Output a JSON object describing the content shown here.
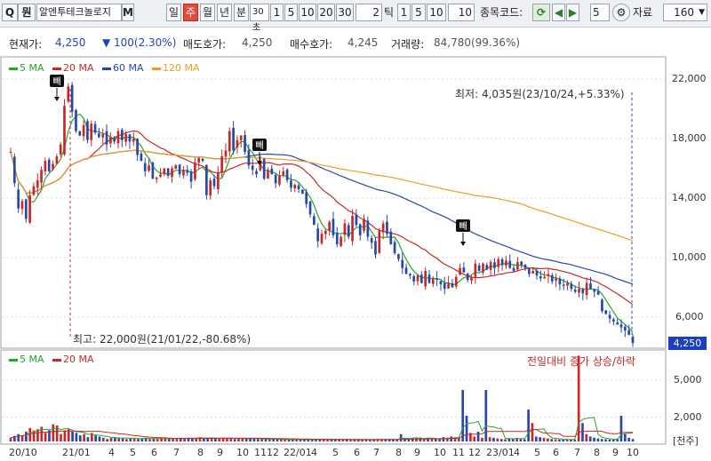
{
  "toolbar": {
    "search_icon_label": "Q",
    "code_button": "뭔",
    "stock_name": "알엔투테크놀로지",
    "mode_m": "M",
    "period_tabs": [
      "일",
      "주",
      "월",
      "년",
      "분"
    ],
    "selected_period": "주",
    "minute_value": "30초",
    "minute_options": [
      "1",
      "5",
      "10",
      "20",
      "30"
    ],
    "tick_value": "2",
    "tick_label": "틱",
    "tick_options": [
      "1",
      "5",
      "10"
    ],
    "tick_input": "10",
    "code_label": "종목코드:",
    "count_value": "5",
    "data_label": "자료",
    "data_count": "160"
  },
  "quote": {
    "current_label": "현재가:",
    "current_value": "4,250",
    "change_arrow": "▼",
    "change_value": "100(2.30%)",
    "ask_label": "매도호가:",
    "ask_value": "4,250",
    "bid_label": "매수호가:",
    "bid_value": "4,245",
    "volume_label": "거래량:",
    "volume_value": "84,780(99.36%)"
  },
  "price_legend": [
    {
      "label": "5 MA",
      "color": "#2aa52a"
    },
    {
      "label": "20 MA",
      "color": "#c8282a"
    },
    {
      "label": "60 MA",
      "color": "#2848a8"
    },
    {
      "label": "120 MA",
      "color": "#e8a020"
    }
  ],
  "volume_legend": [
    {
      "label": "5 MA",
      "color": "#2aa52a"
    },
    {
      "label": "20 MA",
      "color": "#c8282a"
    }
  ],
  "annotations": {
    "low": "최저: 4,035원(23/10/24,+5.33%)",
    "high": "최고: 22,000원(21/01/22,-80.68%)",
    "volume_note": "전일대비 증가 상승/하락",
    "unit": "[천주]",
    "current_price_tag": "4,250",
    "buy_marker": "빼"
  },
  "colors": {
    "up": "#c8282a",
    "down": "#2848a8",
    "ma5": "#2aa52a",
    "ma20": "#c8282a",
    "ma60": "#2848a8",
    "ma120": "#e8a020",
    "current_tag": "#1d3fc1"
  },
  "chart_data": [
    {
      "type": "candlestick",
      "title": "",
      "y_ticks": [
        "22,000",
        "18,000",
        "14,000",
        "10,000",
        "6,000"
      ],
      "ylim": [
        4000,
        22800
      ],
      "x_ticks": [
        "20/10",
        "21/01",
        "4",
        "5",
        "6",
        "7",
        "8",
        "9",
        "10",
        "11",
        "12",
        "22/01",
        "4",
        "5",
        "6",
        "7",
        "8",
        "9",
        "10",
        "11",
        "12",
        "23/01",
        "4",
        "5",
        "6",
        "7",
        "8",
        "9",
        "10"
      ],
      "close": [
        17100,
        15000,
        13300,
        13800,
        12600,
        14200,
        14800,
        15200,
        15900,
        16500,
        15800,
        16300,
        16800,
        17600,
        20200,
        21500,
        19800,
        18500,
        18200,
        18900,
        17900,
        19000,
        18400,
        18100,
        18300,
        17600,
        18100,
        17800,
        18500,
        17900,
        18300,
        17800,
        18000,
        16900,
        16500,
        15800,
        16200,
        15300,
        15400,
        15600,
        16000,
        15500,
        16000,
        16200,
        15600,
        15900,
        15700,
        15100,
        16400,
        16700,
        16500,
        14200,
        15200,
        14800,
        15700,
        16800,
        17200,
        18500,
        17200,
        17900,
        18200,
        17100,
        16200,
        15900,
        15600,
        16500,
        15300,
        15900,
        15600,
        15000,
        15500,
        15800,
        15200,
        14700,
        14900,
        14600,
        14300,
        13600,
        12900,
        12200,
        11100,
        11600,
        11800,
        12400,
        11500,
        10900,
        11400,
        12300,
        11400,
        12800,
        12200,
        11500,
        12600,
        11400,
        11000,
        10200,
        11800,
        12300,
        11600,
        10900,
        10300,
        9900,
        9300,
        8900,
        8800,
        8400,
        8800,
        8300,
        9100,
        8300,
        8600,
        8500,
        8200,
        7900,
        8300,
        8000,
        8700,
        9300,
        9000,
        8500,
        8700,
        9600,
        9100,
        9600,
        9200,
        9700,
        9300,
        9900,
        9500,
        9800,
        9300,
        9100,
        9700,
        9500,
        9300,
        8900,
        9100,
        8800,
        8600,
        8700,
        8900,
        8400,
        8600,
        8200,
        8100,
        8300,
        7900,
        7700,
        7900,
        7600,
        8300,
        7900,
        7700,
        7500,
        6400,
        6200,
        5900,
        5700,
        5500,
        5300,
        5100,
        4800,
        4250
      ]
    },
    {
      "type": "bar",
      "title": "",
      "y_ticks": [
        "5,000",
        "2,000"
      ],
      "ylim": [
        0,
        7200
      ],
      "values": [
        300,
        450,
        600,
        500,
        800,
        1100,
        900,
        1000,
        1200,
        700,
        900,
        1400,
        1300,
        600,
        900,
        1000,
        800,
        700,
        500,
        600,
        350,
        700,
        500,
        400,
        300,
        200,
        300,
        350,
        300,
        250,
        200,
        250,
        300,
        200,
        250,
        300,
        200,
        220,
        200,
        300,
        250,
        200,
        220,
        250,
        300,
        260,
        300,
        250,
        280,
        350,
        250,
        300,
        260,
        250,
        280,
        250,
        300,
        250,
        200,
        220,
        260,
        250,
        240,
        230,
        200,
        210,
        180,
        200,
        190,
        180,
        170,
        160,
        150,
        160,
        170,
        180,
        160,
        150,
        140,
        160,
        170,
        160,
        150,
        200,
        180,
        160,
        170,
        150,
        140,
        160,
        150,
        140,
        130,
        140,
        180,
        200,
        160,
        150,
        170,
        160,
        150,
        600,
        200,
        180,
        250,
        300,
        320,
        200,
        300,
        250,
        180,
        200,
        350,
        300,
        400,
        300,
        250,
        4200,
        2100,
        700,
        400,
        800,
        300,
        4200,
        350,
        300,
        250,
        200,
        180,
        220,
        250,
        300,
        200,
        180,
        2600,
        1500,
        400,
        350,
        300,
        250,
        200,
        180,
        160,
        150,
        170,
        160,
        150,
        7000,
        1500,
        600,
        400,
        300,
        250,
        200,
        180,
        160,
        150,
        200,
        2100,
        600,
        300,
        200
      ]
    }
  ]
}
